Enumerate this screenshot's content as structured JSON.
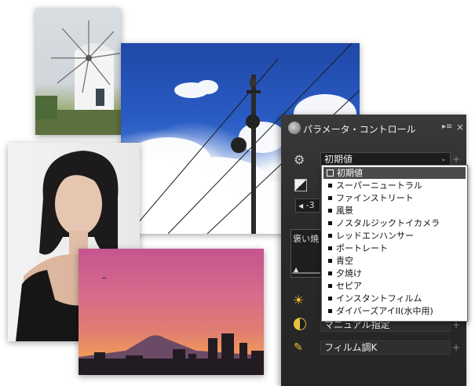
{
  "panel": {
    "title": "パラメータ・コントロール",
    "preset_value": "初期値",
    "minus_value": "-3",
    "memory_label": "褒い焼",
    "manual_label": "マニュアル指定",
    "film_label": "フィルム調K"
  },
  "dropdown": {
    "options": [
      "初期値",
      "スーパーニュートラル",
      "ファインストリート",
      "風景",
      "ノスタルジックトイカメラ",
      "レッドエンハンサー",
      "ポートレート",
      "青空",
      "夕焼け",
      "セピア",
      "インスタントフィルム",
      "ダイバーズアイII(水中用)"
    ],
    "selected_index": 0
  }
}
